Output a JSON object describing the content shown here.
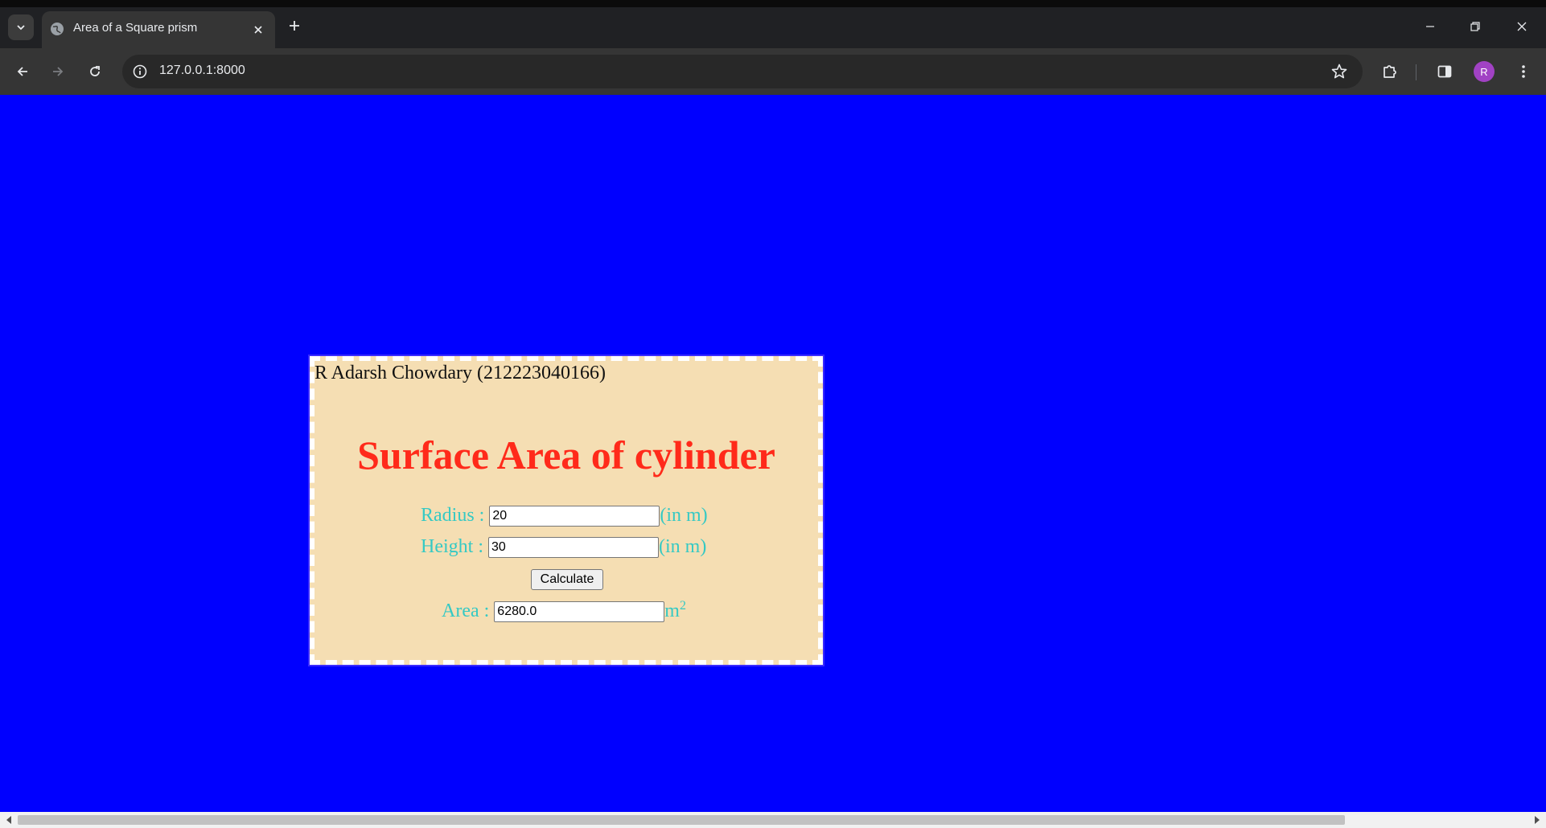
{
  "browser": {
    "tab_title": "Area of a Square prism",
    "url": "127.0.0.1:8000",
    "avatar_letter": "R",
    "accent_avatar": "#a142c4"
  },
  "page": {
    "background": "#0000ff",
    "author": "R Adarsh Chowdary (212223040166)",
    "title": "Surface Area of cylinder",
    "radius": {
      "label": "Radius :",
      "value": "20",
      "unit": "(in m)"
    },
    "height": {
      "label": "Height :",
      "value": "30",
      "unit": "(in m)"
    },
    "calculate_label": "Calculate",
    "area": {
      "label": "Area :",
      "value": "6280.0",
      "unit": "m",
      "unit_sup": "2"
    },
    "colors": {
      "card_bg": "#f5deb3",
      "title": "#ff2a1a",
      "label": "#35c9c4"
    }
  },
  "icons": {
    "tab_search": "chevron-down-icon",
    "favicon": "globe-icon",
    "tab_close": "close-icon",
    "new_tab": "plus-icon",
    "back": "arrow-left-icon",
    "forward": "arrow-right-icon",
    "reload": "reload-icon",
    "site_info": "info-icon",
    "bookmark": "star-icon",
    "extensions": "puzzle-icon",
    "side_panel": "side-panel-icon",
    "menu": "kebab-menu-icon"
  }
}
